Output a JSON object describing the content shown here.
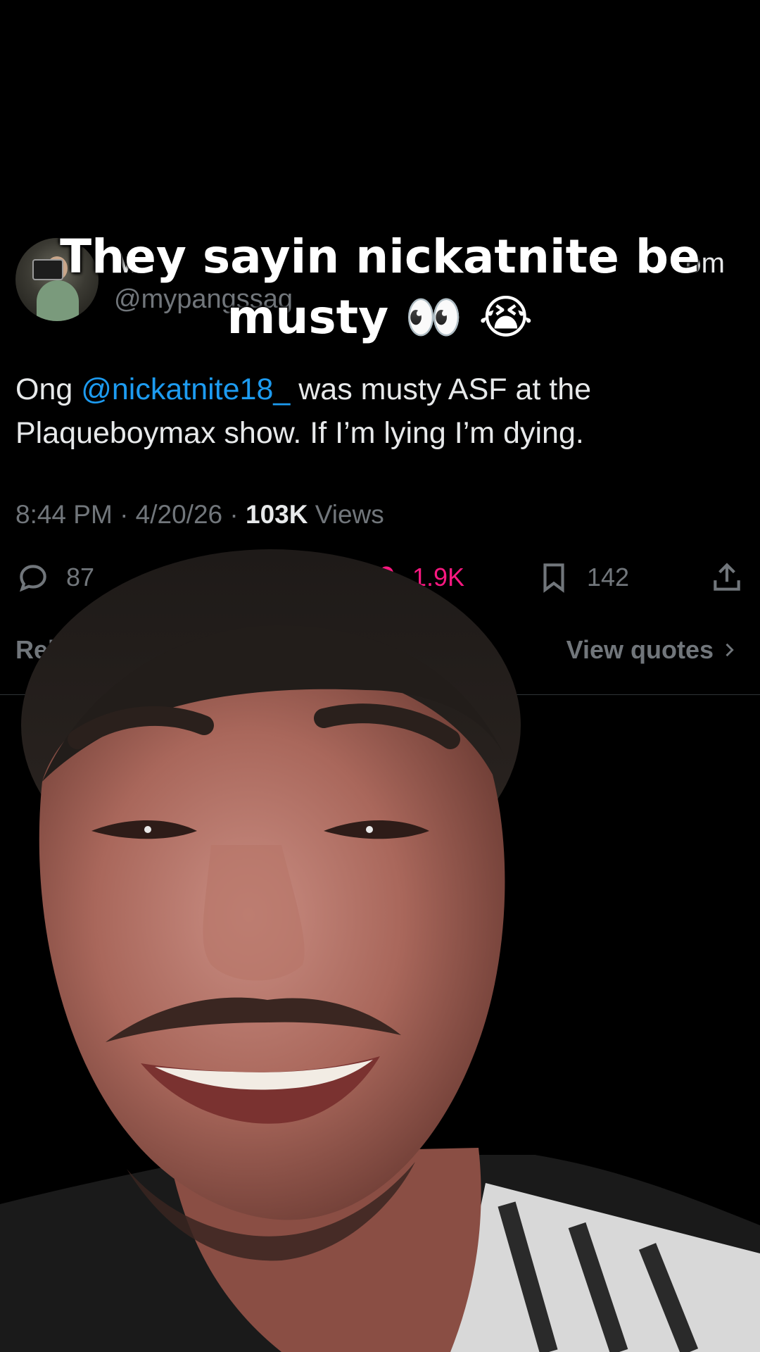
{
  "caption": "They sayin nickatnite be musty 👀 😭",
  "tweet": {
    "display_name": "M",
    "name_suffix": "om",
    "handle": "@mypangssag",
    "body_prefix": "Ong ",
    "mention": "@nickatnite18_",
    "body_suffix": " was musty ASF at the Plaqueboymax show. If I’m lying I’m dying.",
    "time": "8:44 PM · 4/20/26 · ",
    "views_count": "103K",
    "views_label": " Views"
  },
  "actions": {
    "reply_count": "87",
    "like_count": "1.9K",
    "bookmark_count": "142"
  },
  "filters": {
    "left_label": "Releva",
    "right_label": "View quotes"
  },
  "colors": {
    "background": "#000000",
    "mention": "#1d9bf0",
    "like": "#f91880",
    "muted": "#71767b"
  }
}
